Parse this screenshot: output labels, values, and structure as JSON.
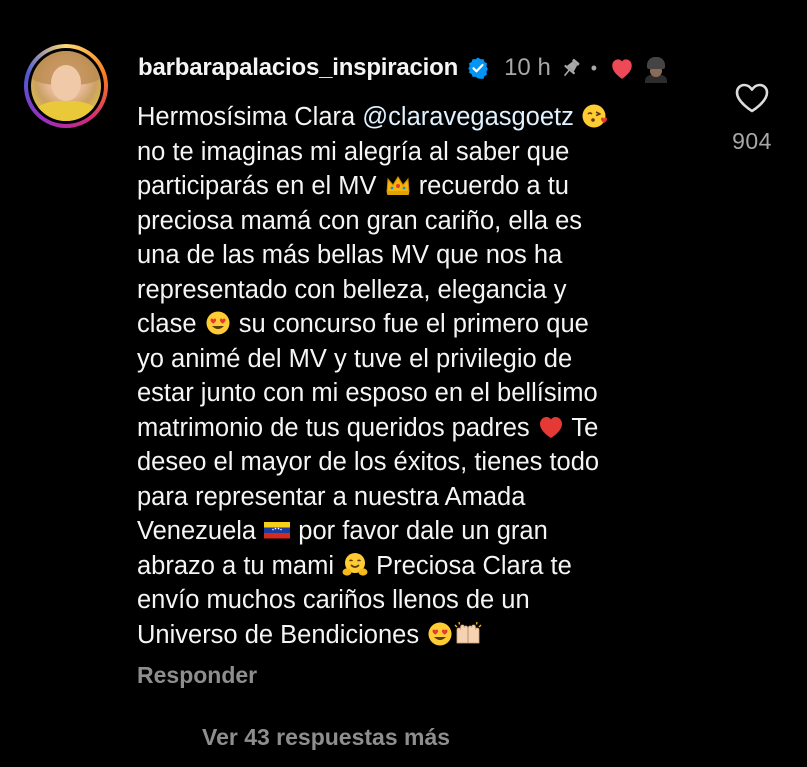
{
  "comment": {
    "username": "barbarapalacios_inspiracion",
    "verified_icon": "verified-badge-icon",
    "time": "10 h",
    "pin_icon": "pin-icon",
    "separator": "•",
    "creator_like_icon": "red-heart-icon",
    "mention": "@claravegasgoetz",
    "lines": [
      "Hermosísima Clara ",
      "no te imaginas mi alegría al saber que",
      "participarás en el MV ",
      " recuerdo a tu",
      "preciosa mamá con gran cariño, ella es",
      "una de las más bellas MV que nos ha",
      "representado con belleza, elegancia y",
      "clase ",
      " su concurso fue el primero que",
      "yo animé del MV y tuve el privilegio de",
      "estar junto con mi esposo en el bellísimo",
      "matrimonio de tus queridos padres ",
      " Te",
      "deseo el mayor de los éxitos, tienes todo",
      "para representar a nuestra Amada",
      "Venezuela ",
      " por favor dale un gran",
      "abrazo a tu mami ",
      " Preciosa Clara te",
      "envío muchos cariños llenos de un",
      "Universo de Bendiciones "
    ],
    "emojis": {
      "kiss": "face-blowing-kiss-emoji",
      "crown": "crown-emoji",
      "heart_eyes": "heart-eyes-emoji",
      "red_heart": "red-heart-emoji",
      "flag": "venezuela-flag-emoji",
      "hug": "hugging-face-emoji",
      "raised_hands": "raising-hands-emoji"
    },
    "like_icon": "heart-outline-icon",
    "like_count": "904",
    "reply_label": "Responder",
    "more_replies_label": "Ver 43 respuestas más"
  },
  "colors": {
    "background": "#000000",
    "text": "#f5f5f5",
    "muted": "#a8a8a8",
    "verified": "#0095f6",
    "heart": "#ed4956"
  }
}
